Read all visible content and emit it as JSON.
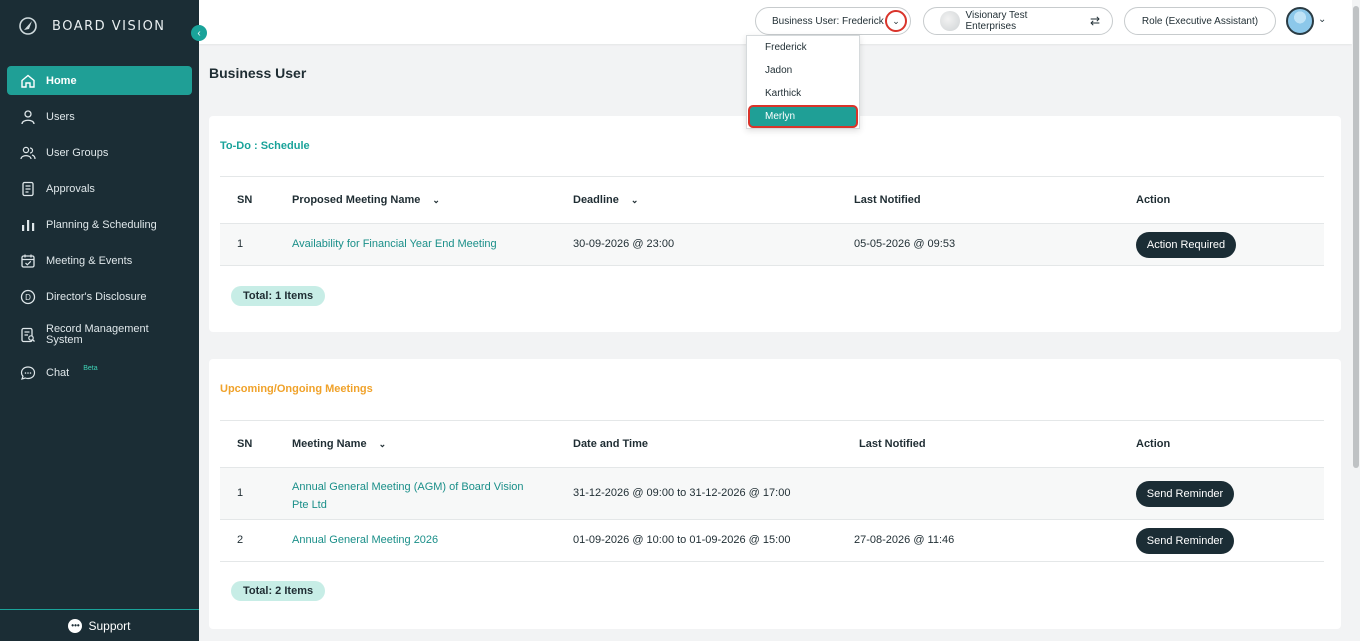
{
  "brand": {
    "name": "BOARD VISION"
  },
  "sidebar": {
    "items": [
      {
        "label": "Home",
        "icon": "home-icon"
      },
      {
        "label": "Users",
        "icon": "user-icon"
      },
      {
        "label": "User Groups",
        "icon": "users-icon"
      },
      {
        "label": "Approvals",
        "icon": "document-icon"
      },
      {
        "label": "Planning & Scheduling",
        "icon": "bar-chart-icon"
      },
      {
        "label": "Meeting & Events",
        "icon": "calendar-check-icon"
      },
      {
        "label": "Director's Disclosure",
        "icon": "d-circle-icon"
      },
      {
        "label": "Record Management System",
        "icon": "record-search-icon"
      },
      {
        "label": "Chat",
        "icon": "chat-icon",
        "badge": "Beta"
      }
    ],
    "support_label": "Support"
  },
  "topbar": {
    "business_user_label": "Business User: Frederick",
    "org_label": "Visionary Test Enterprises",
    "role_label": "Role (Executive Assistant)"
  },
  "dropdown": {
    "options": [
      "Frederick",
      "Jadon",
      "Karthick",
      "Merlyn"
    ],
    "highlighted": "Merlyn"
  },
  "page": {
    "title": "Business User"
  },
  "todo": {
    "title": "To-Do : Schedule",
    "headers": {
      "sn": "SN",
      "name": "Proposed Meeting Name",
      "deadline": "Deadline",
      "last_notified": "Last Notified",
      "action": "Action"
    },
    "rows": [
      {
        "sn": "1",
        "name": "Availability for Financial Year End Meeting",
        "deadline": "30-09-2026 @ 23:00",
        "last_notified": "05-05-2026 @ 09:53",
        "action": "Action Required"
      }
    ],
    "total": "Total: 1 Items"
  },
  "upcoming": {
    "title": "Upcoming/Ongoing Meetings",
    "headers": {
      "sn": "SN",
      "name": "Meeting Name",
      "datetime": "Date and Time",
      "last_notified": "Last Notified",
      "action": "Action"
    },
    "rows": [
      {
        "sn": "1",
        "name_line1": "Annual General Meeting (AGM) of Board Vision",
        "name_line2": "Pte Ltd",
        "datetime": "31-12-2026 @ 09:00 to 31-12-2026 @ 17:00",
        "last_notified": "",
        "action": "Send Reminder"
      },
      {
        "sn": "2",
        "name": "Annual General Meeting 2026",
        "datetime": "01-09-2026 @ 10:00 to 01-09-2026 @ 15:00",
        "last_notified": "27-08-2026 @ 11:46",
        "action": "Send Reminder"
      }
    ],
    "total": "Total: 2 Items"
  },
  "colors": {
    "sidebar_bg": "#1b2d35",
    "accent": "#1f9f96",
    "warning": "#f0a22a",
    "highlight_border": "#d9342b"
  }
}
